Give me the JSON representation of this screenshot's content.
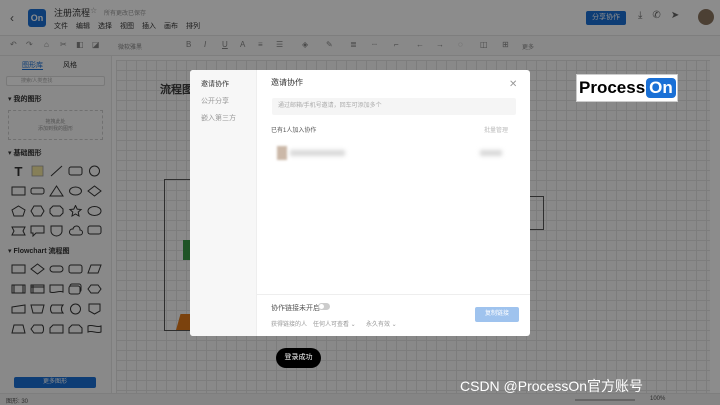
{
  "titlebar": {
    "doc_title": "注册流程",
    "saved_status": "所有更改已保存",
    "logo_text": "On",
    "menu": [
      "文件",
      "编辑",
      "选择",
      "视图",
      "插入",
      "画布",
      "排列"
    ],
    "share_label": "分享协作"
  },
  "toolbar": {
    "font_select": "微软雅黑",
    "more_label": "更多"
  },
  "sidebar": {
    "tabs": [
      "图形库",
      "风格"
    ],
    "search_placeholder": "搜索/人类查找",
    "my_shapes_title": "我的图形",
    "my_shapes_hint_1": "拖拽此处",
    "my_shapes_hint_2": "添加到我的图形",
    "basic_title": "基础图形",
    "flowchart_title": "Flowchart 流程图",
    "more_shapes_label": "更多图形"
  },
  "status": {
    "shapes_count": "图形: 30",
    "zoom": "100%"
  },
  "canvas": {
    "title": "流程图",
    "logo_text": "Process",
    "logo_on": "On",
    "node_label": "登录成功",
    "watermark": "CSDN @ProcessOn官方账号"
  },
  "modal": {
    "tabs": [
      "邀请协作",
      "公开分享",
      "嵌入第三方"
    ],
    "title": "邀请协作",
    "input_placeholder": "通过邮箱/手机号邀请，回车可添加多个",
    "joined_label": "已有1人加入协作",
    "batch_label": "批量管理",
    "link_label": "协作链接未开启",
    "perm_1": "获得链接的人",
    "perm_2": "任何人可查看",
    "perm_3": "永久有效",
    "copy_label": "复制链接"
  },
  "colors": {
    "brand": "#1a70d6"
  }
}
